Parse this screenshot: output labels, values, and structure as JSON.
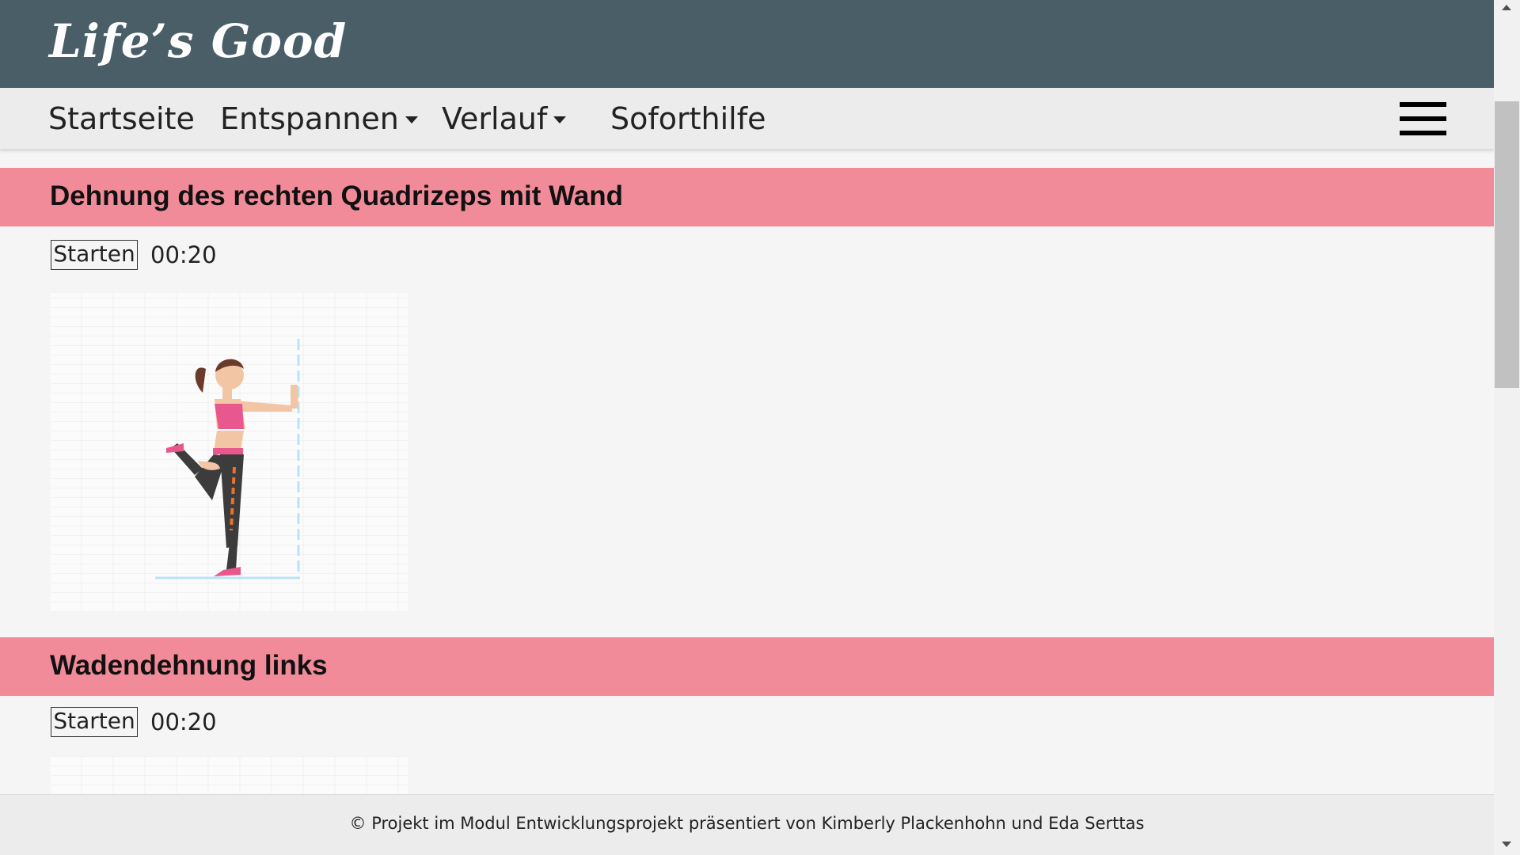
{
  "header": {
    "logo": "Life’s Good"
  },
  "nav": {
    "items": [
      {
        "label": "Startseite",
        "has_dropdown": false
      },
      {
        "label": "Entspannen",
        "has_dropdown": true
      },
      {
        "label": "Verlauf",
        "has_dropdown": true
      },
      {
        "label": "Soforthilfe",
        "has_dropdown": false
      }
    ],
    "menu_icon": "hamburger-menu-icon"
  },
  "exercises": [
    {
      "title": "Dehnung des rechten Quadrizeps mit Wand",
      "button_label": "Starten",
      "timer": "00:20",
      "illustration": "quadriceps-stretch-illustration"
    },
    {
      "title": "Wadendehnung links",
      "button_label": "Starten",
      "timer": "00:20",
      "illustration": "calf-stretch-illustration"
    }
  ],
  "footer": {
    "text": "© Projekt im Modul Entwicklungsprojekt präsentiert von Kimberly Plackenhohn und Eda Serttas"
  },
  "colors": {
    "header_bg": "#4a5e68",
    "section_bar": "#f28b99",
    "nav_bg": "#ececec",
    "page_bg": "#f5f5f5"
  }
}
